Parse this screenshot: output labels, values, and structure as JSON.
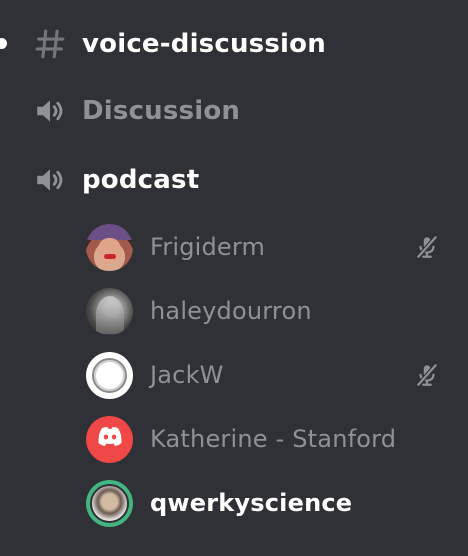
{
  "channels": [
    {
      "name": "voice-discussion",
      "icon": "hash-icon",
      "state": "unread"
    },
    {
      "name": "Discussion",
      "icon": "speaker-icon",
      "state": "muted"
    },
    {
      "name": "podcast",
      "icon": "speaker-icon",
      "state": "connected"
    }
  ],
  "voice_users": [
    {
      "name": "Frigiderm",
      "avatar": "photo",
      "status_icon": "mic-muted-icon"
    },
    {
      "name": "haleydourron",
      "avatar": "photo",
      "status_icon": null
    },
    {
      "name": "JackW",
      "avatar": "ring-image",
      "status_icon": "mic-muted-icon"
    },
    {
      "name": "Katherine - Stanford",
      "avatar": "discord-logo",
      "status_icon": null
    },
    {
      "name": "qwerkyscience",
      "avatar": "photo",
      "status_icon": null,
      "speaking": true
    }
  ],
  "colors": {
    "background": "#2f3136",
    "text_active": "#ffffff",
    "text_muted": "#8e9297",
    "icon": "#8e9297",
    "speaking_ring": "#43b581",
    "discord_red": "#f04747"
  }
}
